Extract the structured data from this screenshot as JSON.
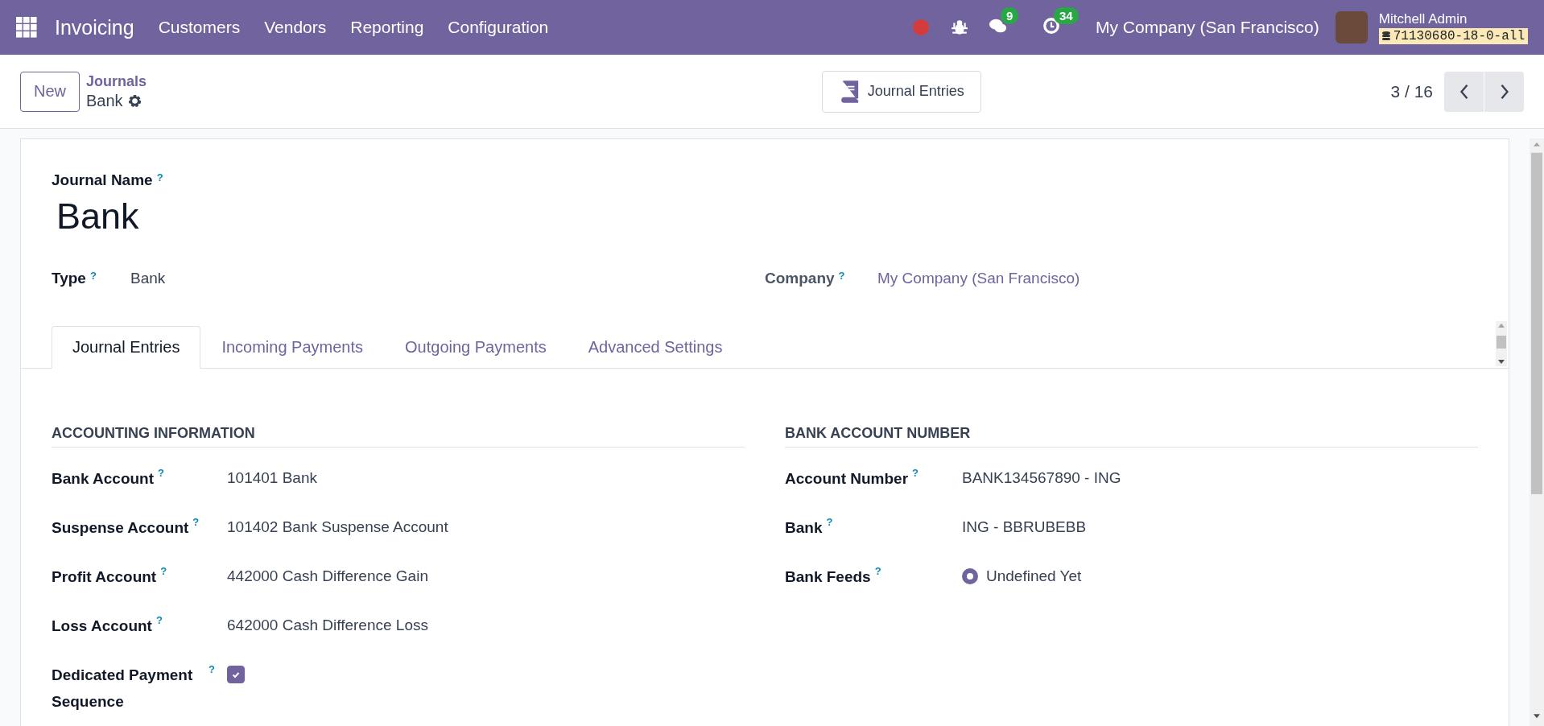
{
  "navbar": {
    "app_name": "Invoicing",
    "menus": [
      "Customers",
      "Vendors",
      "Reporting",
      "Configuration"
    ],
    "messages_count": "9",
    "activities_count": "34",
    "company": "My Company (San Francisco)",
    "user_name": "Mitchell Admin",
    "database": "71130680-18-0-all"
  },
  "control_panel": {
    "new_button": "New",
    "breadcrumb": "Journals",
    "record": "Bank",
    "smart_button": "Journal Entries",
    "pager": "3 / 16"
  },
  "form": {
    "name_label": "Journal Name",
    "name_help": "?",
    "name": "Bank",
    "type": {
      "label": "Type",
      "help": "?",
      "value": "Bank"
    },
    "company": {
      "label": "Company",
      "help": "?",
      "value": "My Company (San Francisco)"
    },
    "tabs": [
      {
        "label": "Journal Entries",
        "selected": true
      },
      {
        "label": "Incoming Payments",
        "selected": false
      },
      {
        "label": "Outgoing Payments",
        "selected": false
      },
      {
        "label": "Advanced Settings",
        "selected": false
      }
    ],
    "sections": [
      {
        "title": "ACCOUNTING INFORMATION",
        "fields": [
          {
            "kind": "text",
            "label": "Bank Account",
            "help": "?",
            "value": "101401 Bank"
          },
          {
            "kind": "text",
            "label": "Suspense Account",
            "help": "?",
            "value": "101402 Bank Suspense Account"
          },
          {
            "kind": "text",
            "label": "Profit Account",
            "help": "?",
            "value": "442000 Cash Difference Gain"
          },
          {
            "kind": "text",
            "label": "Loss Account",
            "help": "?",
            "value": "642000 Cash Difference Loss"
          },
          {
            "kind": "checkbox",
            "label": "Dedicated Payment Sequence",
            "help": "?",
            "checked": true
          }
        ]
      },
      {
        "title": "BANK ACCOUNT NUMBER",
        "fields": [
          {
            "kind": "text",
            "label": "Account Number",
            "help": "?",
            "value": "BANK134567890 - ING"
          },
          {
            "kind": "text",
            "label": "Bank",
            "help": "?",
            "value": "ING - BBRUBEBB"
          },
          {
            "kind": "radio",
            "label": "Bank Feeds",
            "help": "?",
            "value": "Undefined Yet",
            "selected": true
          }
        ]
      }
    ]
  }
}
